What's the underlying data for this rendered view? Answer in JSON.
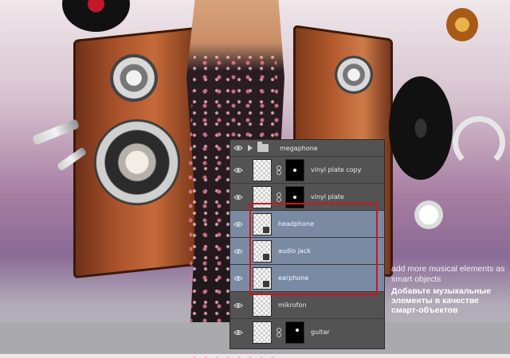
{
  "layers_panel": {
    "group": {
      "name": "megaphone",
      "icon": "folder-icon",
      "expand_icon": "triangle-right-icon"
    },
    "layers": [
      {
        "name": "vinyl plate copy",
        "selected": false,
        "has_mask": true
      },
      {
        "name": "vinyl plate",
        "selected": false,
        "has_mask": true
      },
      {
        "name": "headphone",
        "selected": true,
        "has_mask": false
      },
      {
        "name": "audio jack",
        "selected": true,
        "has_mask": false
      },
      {
        "name": "earphone",
        "selected": true,
        "has_mask": false
      },
      {
        "name": "mikrofon",
        "selected": false,
        "has_mask": false
      },
      {
        "name": "guitar",
        "selected": false,
        "has_mask": true
      }
    ],
    "selection_color": "#7b8aa3",
    "highlight_color": "#d0141e"
  },
  "captions": {
    "en": "add more musical elements as smart objects",
    "ru": "Добавьте музыкальные элементы в качестве смарт-объектов"
  }
}
